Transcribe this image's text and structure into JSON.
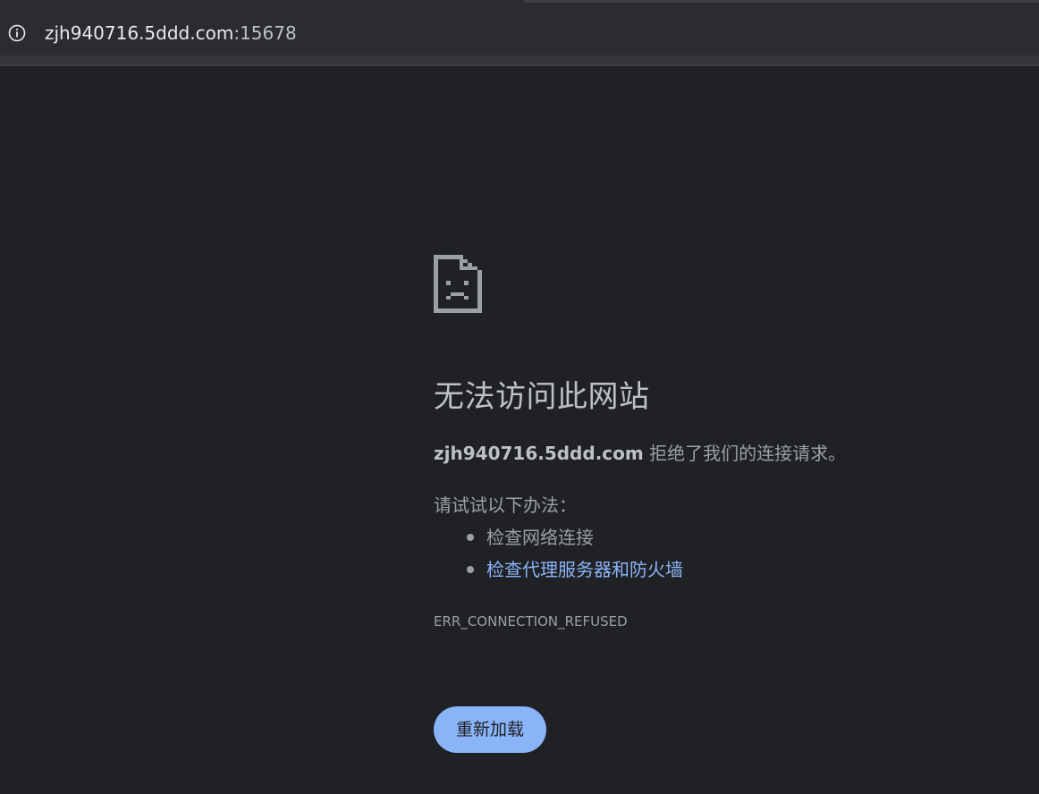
{
  "address_bar": {
    "url_host": "zjh940716.5ddd.com",
    "url_port": ":15678",
    "info_icon": "info-icon"
  },
  "error_page": {
    "icon": "sad-document-icon",
    "title": "无法访问此网站",
    "host": "zjh940716.5ddd.com",
    "message_suffix": " 拒绝了我们的连接请求。",
    "try_label": "请试试以下办法：",
    "suggestions": [
      {
        "label": "检查网络连接",
        "is_link": false
      },
      {
        "label": "检查代理服务器和防火墙",
        "is_link": true
      }
    ],
    "error_code": "ERR_CONNECTION_REFUSED",
    "reload_label": "重新加载"
  },
  "colors": {
    "background": "#202124",
    "text": "#9aa0a6",
    "link": "#8ab4f8",
    "button": "#8ab4f8"
  }
}
